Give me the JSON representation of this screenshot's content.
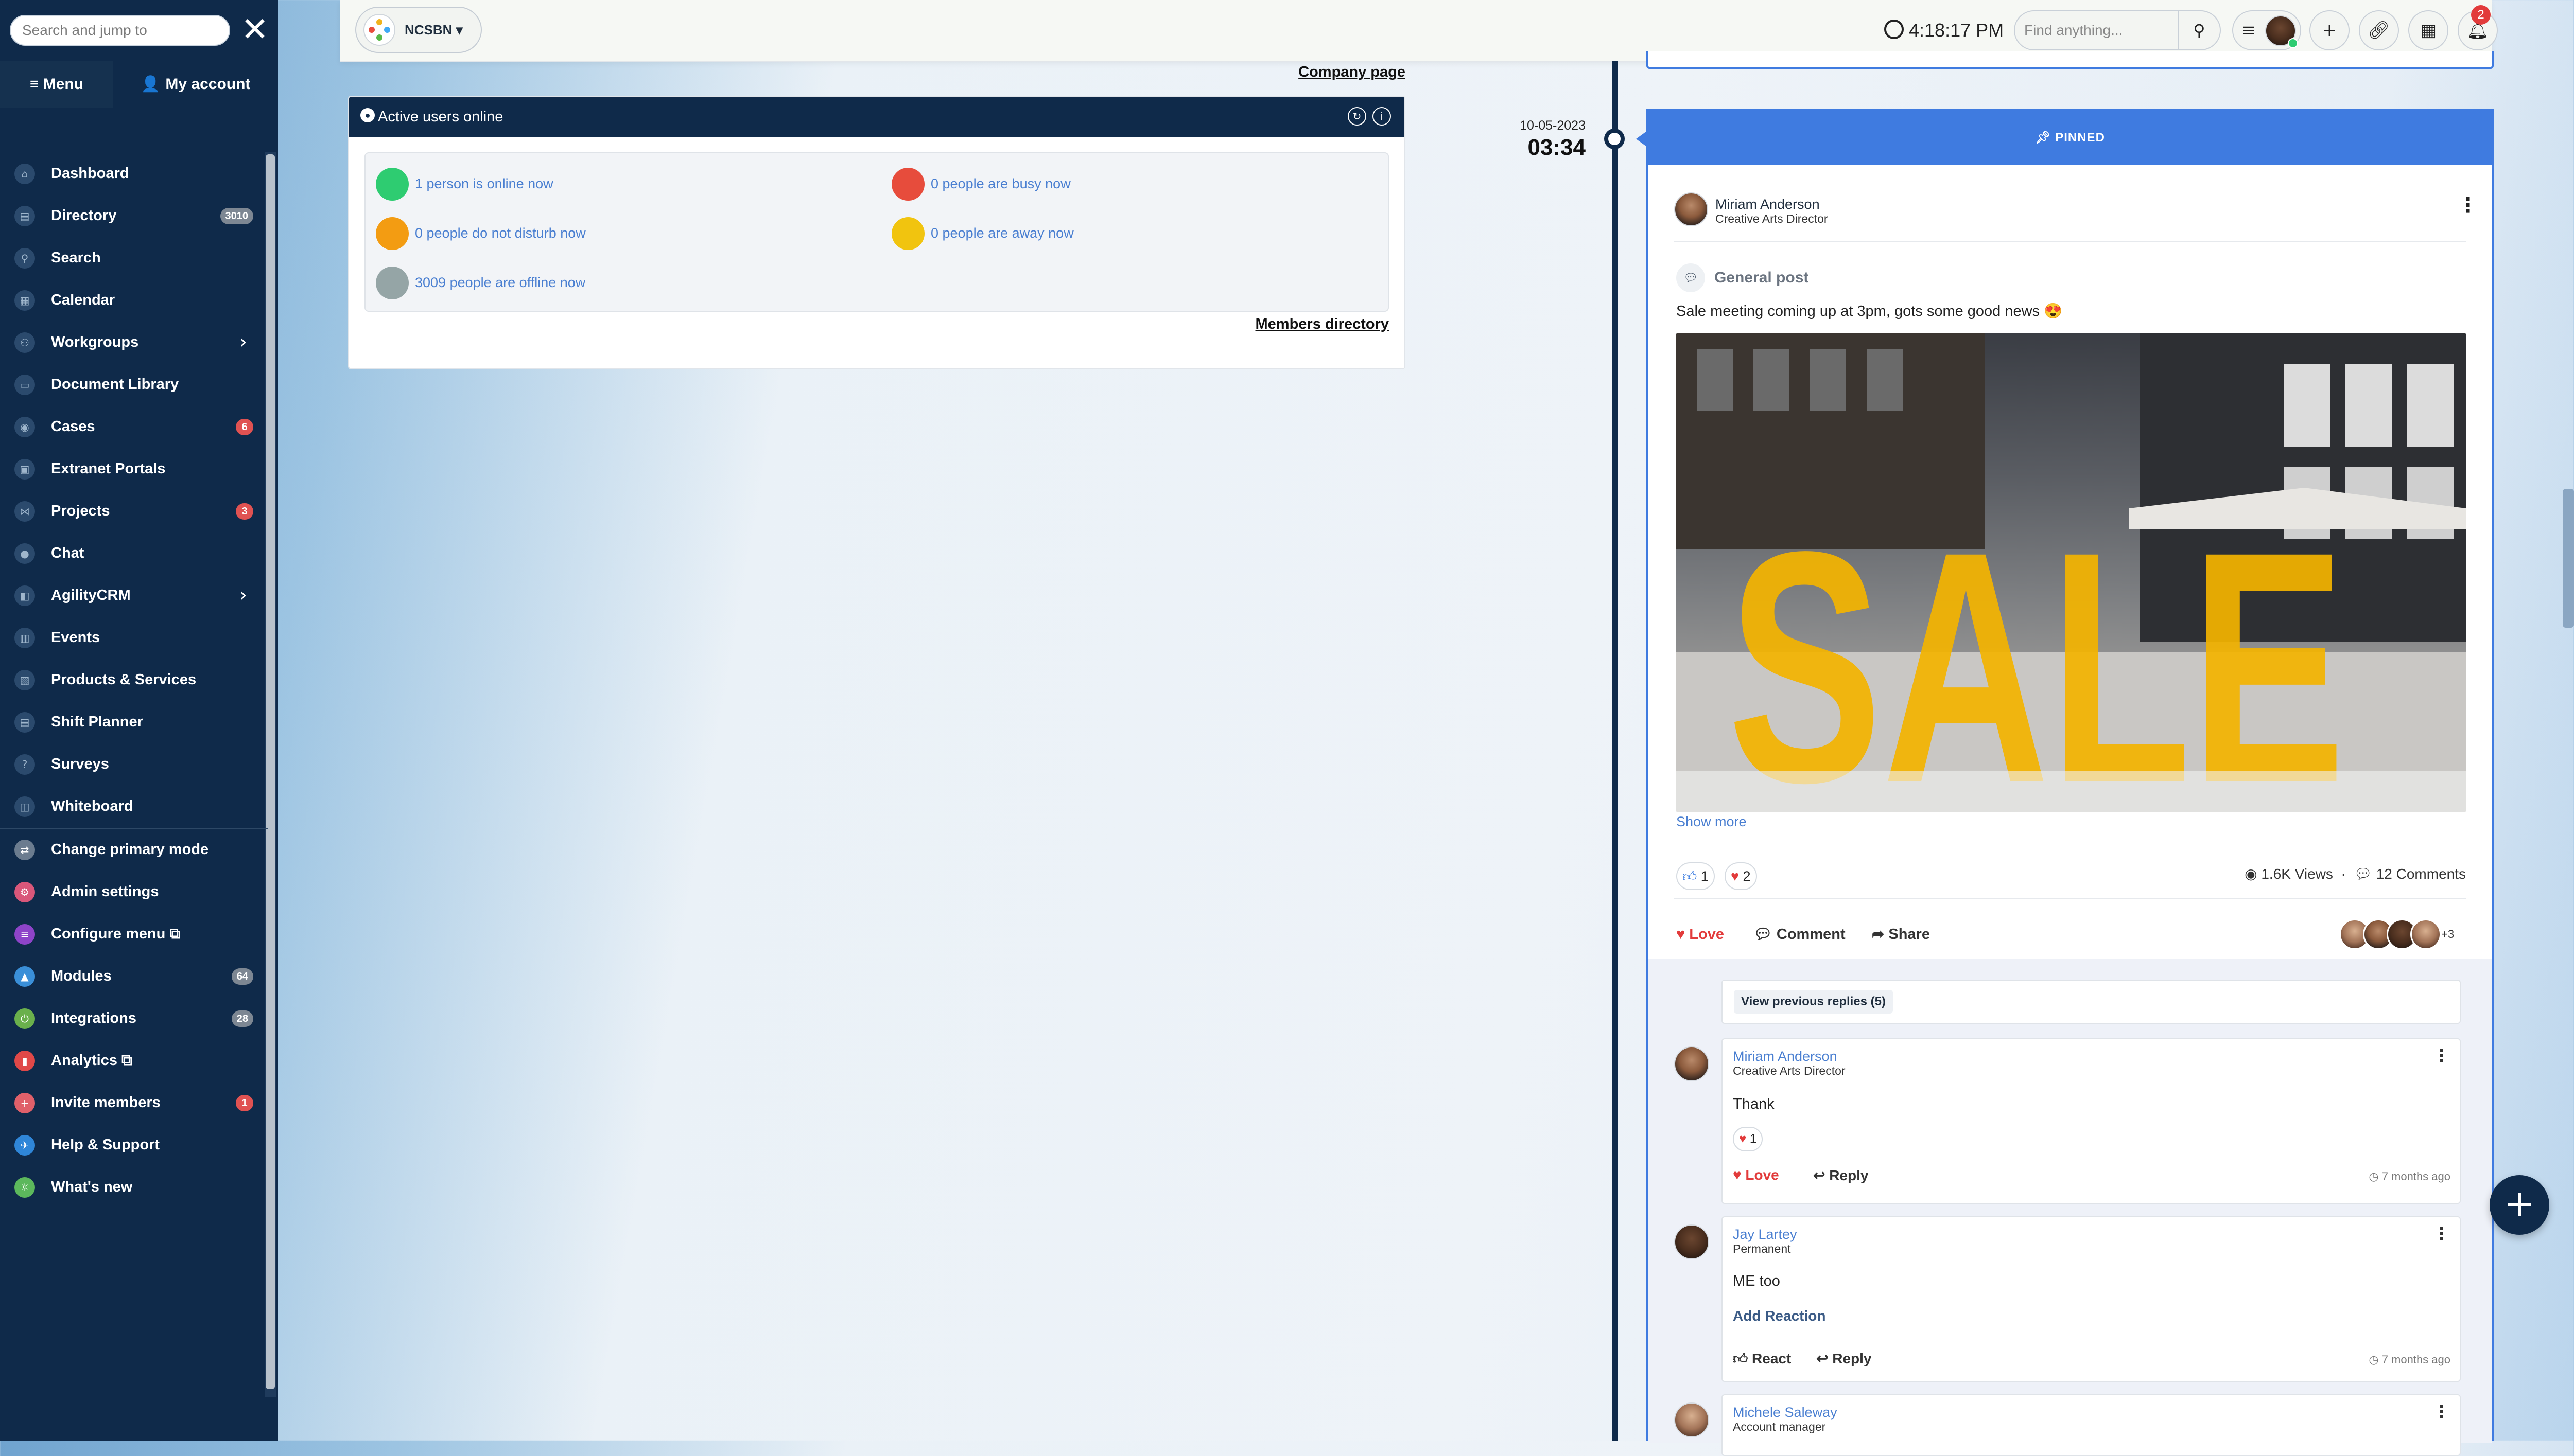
{
  "sidebar": {
    "search_placeholder": "Search and jump to",
    "tabs": {
      "menu": "Menu",
      "account": "My account"
    },
    "items": [
      {
        "label": "Dashboard",
        "icon": "dashboard-icon"
      },
      {
        "label": "Directory",
        "icon": "directory-icon",
        "badge": "3010"
      },
      {
        "label": "Search",
        "icon": "search-icon"
      },
      {
        "label": "Calendar",
        "icon": "calendar-icon"
      },
      {
        "label": "Workgroups",
        "icon": "workgroups-icon",
        "expandable": true
      },
      {
        "label": "Document Library",
        "icon": "document-library-icon"
      },
      {
        "label": "Cases",
        "icon": "cases-icon",
        "badge": "6"
      },
      {
        "label": "Extranet Portals",
        "icon": "extranet-icon"
      },
      {
        "label": "Projects",
        "icon": "projects-icon",
        "badge": "3"
      },
      {
        "label": "Chat",
        "icon": "chat-icon"
      },
      {
        "label": "AgilityCRM",
        "icon": "crm-icon",
        "expandable": true
      },
      {
        "label": "Events",
        "icon": "events-icon"
      },
      {
        "label": "Products & Services",
        "icon": "products-icon"
      },
      {
        "label": "Shift Planner",
        "icon": "shift-planner-icon"
      },
      {
        "label": "Surveys",
        "icon": "surveys-icon"
      },
      {
        "label": "Whiteboard",
        "icon": "whiteboard-icon"
      }
    ],
    "admin_items": [
      {
        "label": "Change primary mode",
        "icon": "swap-icon",
        "color": "#6b7c8f"
      },
      {
        "label": "Admin settings",
        "icon": "admin-icon",
        "color": "#d9577a"
      },
      {
        "label": "Configure menu",
        "icon": "menu-config-icon",
        "color": "#8e44c9",
        "external": true
      },
      {
        "label": "Modules",
        "icon": "modules-icon",
        "color": "#3a8fd8",
        "badge": "64"
      },
      {
        "label": "Integrations",
        "icon": "integrations-icon",
        "color": "#6ab04c",
        "badge": "28"
      },
      {
        "label": "Analytics",
        "icon": "analytics-icon",
        "color": "#e04848",
        "external": true
      },
      {
        "label": "Invite members",
        "icon": "invite-icon",
        "color": "#e0606a",
        "badge": "1"
      },
      {
        "label": "Help & Support",
        "icon": "help-icon",
        "color": "#2f86d8"
      },
      {
        "label": "What's new",
        "icon": "whats-new-icon",
        "color": "#5cb85c"
      }
    ]
  },
  "topbar": {
    "org_name": "NCSBN",
    "time": "4:18:17 PM",
    "find_placeholder": "Find anything...",
    "notification_count": "2"
  },
  "main": {
    "company_page_link": "Company page",
    "widget": {
      "title": "Active users online",
      "statuses": [
        {
          "text": "1 person is online now",
          "color": "#2ecc71"
        },
        {
          "text": "0 people are busy now",
          "color": "#e74c3c"
        },
        {
          "text": "0 people do not disturb now",
          "color": "#f39c12"
        },
        {
          "text": "0 people are away now",
          "color": "#f1c40f"
        },
        {
          "text": "3009 people are offline now",
          "color": "#95a5a6"
        }
      ],
      "members_directory_link": "Members directory"
    }
  },
  "timeline": {
    "date": "10-05-2023",
    "time": "03:34"
  },
  "post": {
    "pinned_label": "PINNED",
    "author_name": "Miriam Anderson",
    "author_role": "Creative Arts Director",
    "type_label": "General post",
    "text": "Sale meeting coming up at 3pm, gots some good news 😍",
    "image_word": "SALE",
    "show_more": "Show more",
    "like_count": "1",
    "love_count": "2",
    "views": "1.6K Views",
    "comments": "12 Comments",
    "actions": {
      "love": "Love",
      "comment": "Comment",
      "share": "Share"
    },
    "more_reactors": "+3",
    "view_previous": "View previous replies (5)",
    "replies": [
      {
        "name": "Miriam Anderson",
        "role": "Creative Arts Director",
        "text": "Thank",
        "reaction_count": "1",
        "action1": "Love",
        "action2": "Reply",
        "time": "7 months ago"
      },
      {
        "name": "Jay Lartey",
        "role": "Permanent",
        "text": "ME too",
        "add_reaction": "Add Reaction",
        "action1": "React",
        "action2": "Reply",
        "time": "7 months ago"
      },
      {
        "name": "Michele Saleway",
        "role": "Account manager"
      }
    ]
  },
  "colors": {
    "sidebar_bg": "#0f2a4a",
    "accent_blue": "#3f7be0",
    "love_red": "#e23b3b",
    "link_blue": "#4a7fd1"
  }
}
